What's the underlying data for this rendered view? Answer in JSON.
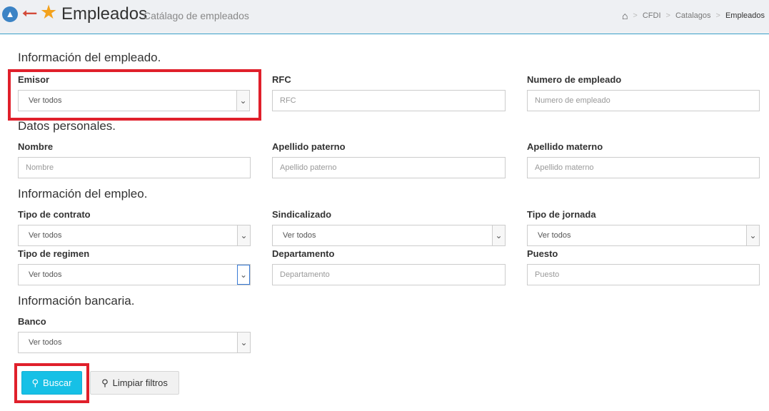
{
  "header": {
    "title": "Empleados",
    "subtitle": "Catálago de empleados",
    "breadcrumb": [
      "CFDI",
      "Catalagos",
      "Empleados"
    ]
  },
  "sections": {
    "empleado": "Información del empleado.",
    "personales": "Datos personales.",
    "empleo": "Información del empleo.",
    "bancaria": "Información bancaria."
  },
  "fields": {
    "emisor": {
      "label": "Emisor",
      "value": "Ver todos"
    },
    "rfc": {
      "label": "RFC",
      "placeholder": "RFC"
    },
    "numero_empleado": {
      "label": "Numero de empleado",
      "placeholder": "Numero de empleado"
    },
    "nombre": {
      "label": "Nombre",
      "placeholder": "Nombre"
    },
    "apellido_paterno": {
      "label": "Apellido paterno",
      "placeholder": "Apellido paterno"
    },
    "apellido_materno": {
      "label": "Apellido materno",
      "placeholder": "Apellido materno"
    },
    "tipo_contrato": {
      "label": "Tipo de contrato",
      "value": "Ver todos"
    },
    "sindicalizado": {
      "label": "Sindicalizado",
      "value": "Ver todos"
    },
    "tipo_jornada": {
      "label": "Tipo de jornada",
      "value": "Ver todos"
    },
    "tipo_regimen": {
      "label": "Tipo de regimen",
      "value": "Ver todos"
    },
    "departamento": {
      "label": "Departamento",
      "placeholder": "Departamento"
    },
    "puesto": {
      "label": "Puesto",
      "placeholder": "Puesto"
    },
    "banco": {
      "label": "Banco",
      "value": "Ver todos"
    }
  },
  "buttons": {
    "buscar": "Buscar",
    "limpiar": "Limpiar filtros"
  },
  "icons": {
    "pin": "pin-icon",
    "back": "arrow-left-icon",
    "star": "star-icon",
    "home": "home-icon",
    "search": "search-icon",
    "caret": "chevron-down-icon"
  },
  "colors": {
    "primary_button": "#16c0e6",
    "highlight": "#e0202b",
    "back_arrow": "#d34b3a",
    "star": "#f3a21d"
  }
}
